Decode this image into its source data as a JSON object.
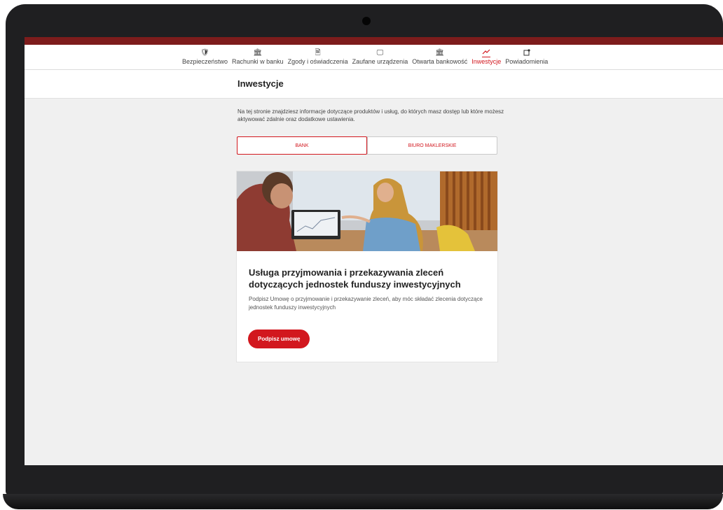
{
  "nav": {
    "items": [
      {
        "label": "Bezpieczeństwo",
        "icon": "shield-icon"
      },
      {
        "label": "Rachunki w banku",
        "icon": "bank-icon"
      },
      {
        "label": "Zgody i oświadczenia",
        "icon": "document-icon"
      },
      {
        "label": "Zaufane urządzenia",
        "icon": "monitor-icon"
      },
      {
        "label": "Otwarta bankowość",
        "icon": "bank-icon"
      },
      {
        "label": "Inwestycje",
        "icon": "chart-icon",
        "active": true
      },
      {
        "label": "Powiadomienia",
        "icon": "notification-icon"
      }
    ]
  },
  "page": {
    "title": "Inwestycje",
    "intro": "Na tej stronie znajdziesz informacje dotyczące produktów i usług, do których masz dostęp lub które możesz aktywować zdalnie oraz dodatkowe ustawienia."
  },
  "tabs": [
    {
      "label": "BANK",
      "active": true
    },
    {
      "label": "BIURO MAKLERSKIE",
      "active": false
    }
  ],
  "card": {
    "title": "Usługa przyjmowania i przekazywania zleceń dotyczących jednostek funduszy inwestycyjnych",
    "description": "Podpisz Umowę o przyjmowanie i przekazywanie zleceń, aby móc składać zlecenia dotyczące jednostek funduszy inwestycyjnych",
    "button_label": "Podpisz umowę"
  },
  "colors": {
    "accent": "#d2171e",
    "topbar": "#7d1c1c",
    "background": "#f0f0f0"
  }
}
